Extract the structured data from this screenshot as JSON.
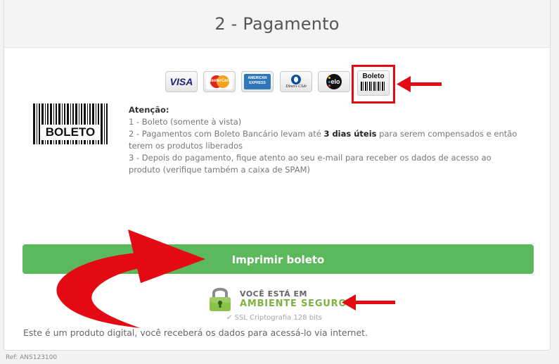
{
  "header": {
    "title": "2 - Pagamento"
  },
  "payment_methods": [
    {
      "name": "VISA",
      "icon": "visa-icon"
    },
    {
      "name": "MasterCard",
      "icon": "mastercard-icon"
    },
    {
      "name": "AMERICAN EXPRESS",
      "icon": "amex-icon"
    },
    {
      "name": "Diners Club",
      "icon": "diners-icon"
    },
    {
      "name": "elo",
      "icon": "elo-icon"
    },
    {
      "name": "Boleto",
      "icon": "boleto-icon",
      "selected": true
    }
  ],
  "barcode_label": "BOLETO",
  "info": {
    "title": "Atenção:",
    "line1": "1 - Boleto (somente à vista)",
    "line2_pre": "2 - Pagamentos com Boleto Bancário levam até ",
    "line2_bold": "3 dias úteis",
    "line2_post": " para serem compensados e então terem os produtos liberados",
    "line3": "3 - Depois do pagamento, fique atento ao seu e-mail para receber os dados de acesso ao produto (verifique também a caixa de SPAM)"
  },
  "print_button": "Imprimir boleto",
  "secure": {
    "line1": "VOCÊ ESTÁ EM",
    "line2": "AMBIENTE SEGURO",
    "ssl_check": "✔",
    "ssl": "SSL Criptografia 128 bits"
  },
  "digital_note": "Este é um produto digital, você receberá os dados para acessá-lo via internet.",
  "ref": "Ref: ANS123100",
  "colors": {
    "button": "#5cb85c",
    "secure_green": "#7cb342",
    "highlight_red": "#e30a13"
  }
}
